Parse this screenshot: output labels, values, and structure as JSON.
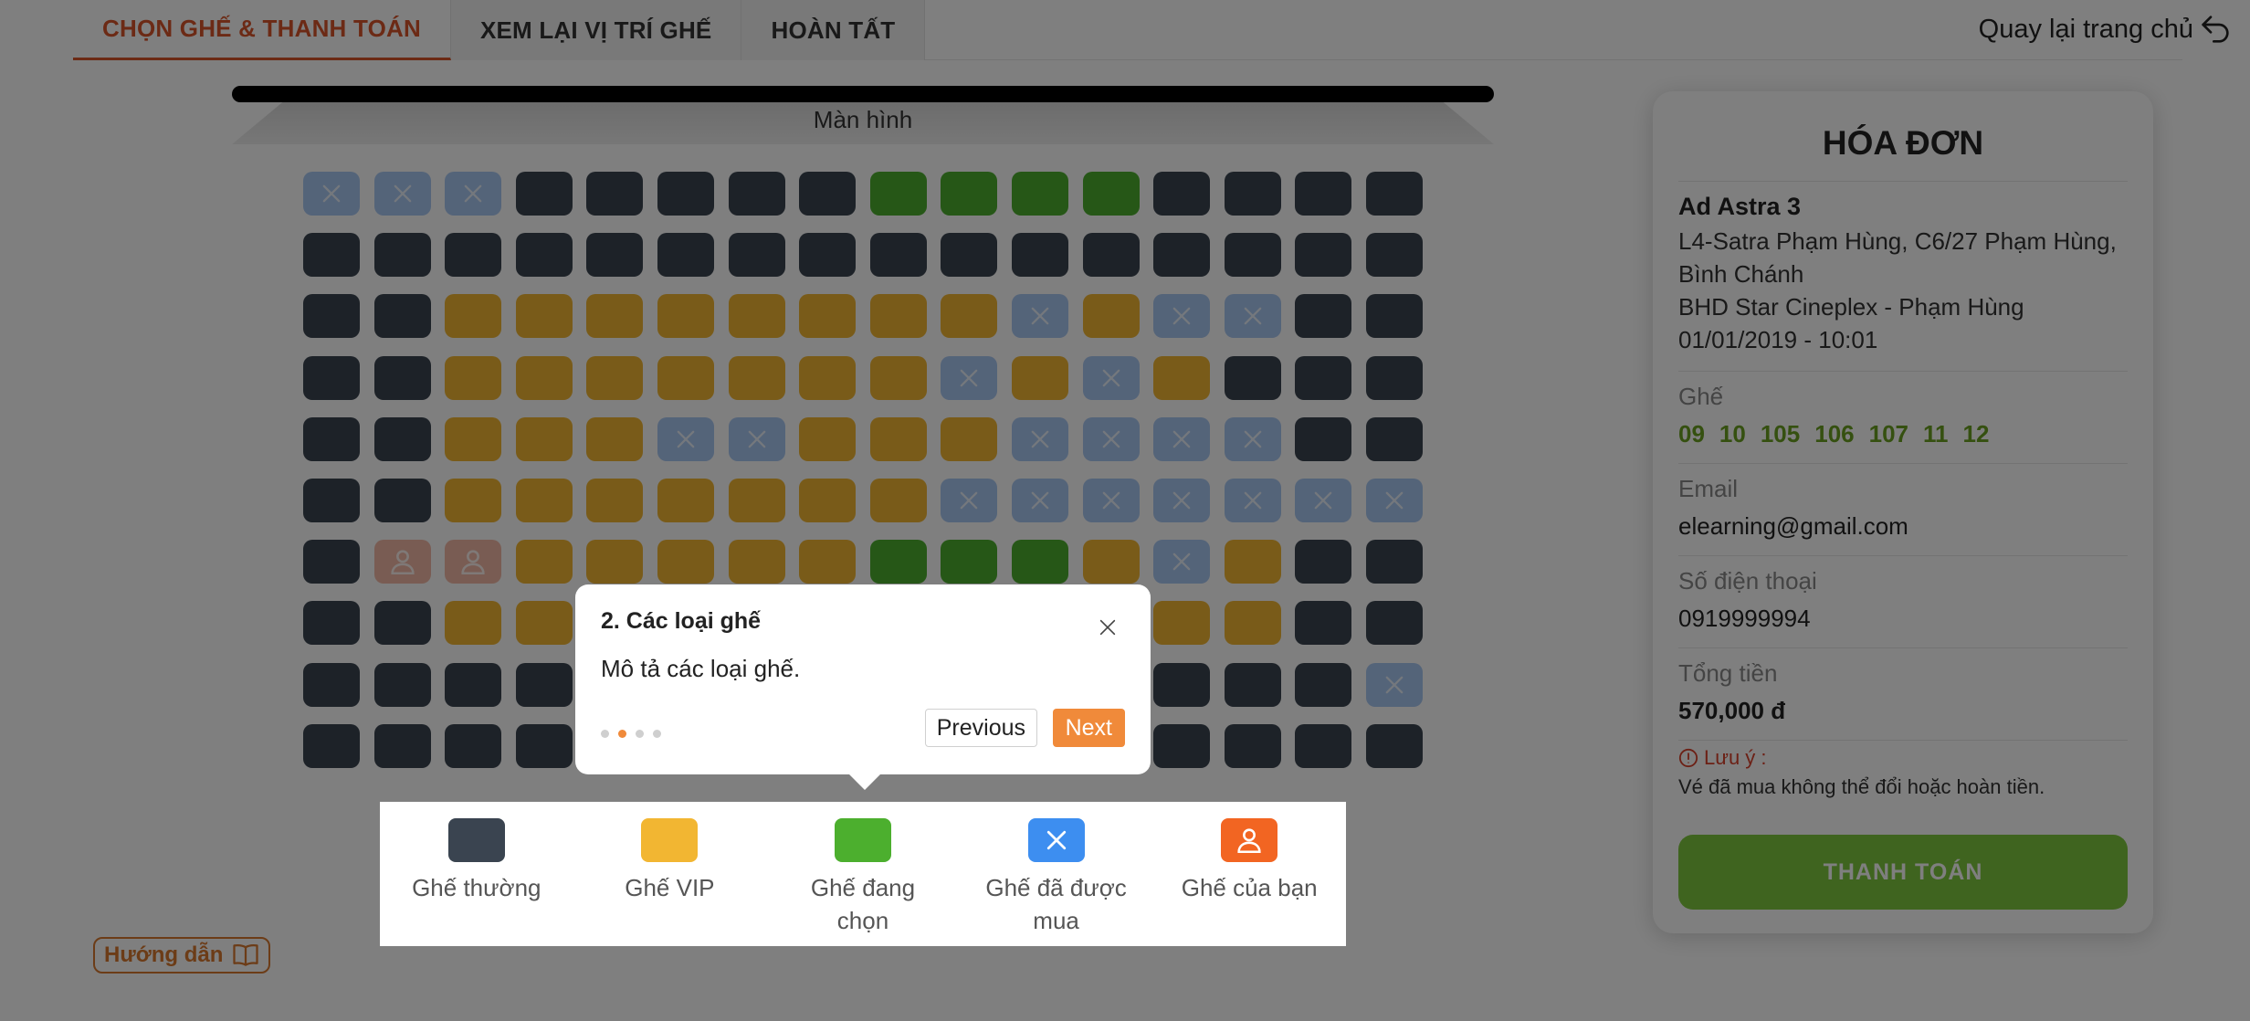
{
  "tabs": [
    {
      "label": "CHỌN GHẾ & THANH TOÁN",
      "active": true
    },
    {
      "label": "XEM LẠI VỊ TRÍ GHẾ",
      "active": false
    },
    {
      "label": "HOÀN TẤT",
      "active": false
    }
  ],
  "header": {
    "back_home": "Quay lại trang chủ",
    "back_icon": "undo-arrow-icon"
  },
  "screen": {
    "label": "Màn hình"
  },
  "seat_map": {
    "legend_codes": {
      "N": "normal",
      "V": "vip",
      "S": "selected",
      "X": "sold",
      "Y": "yours"
    },
    "rows": [
      "XXXNNNNNSSSSNNNN",
      "NNNNNNNNNNNNNNNN",
      "NNVVVVVVVVXVXXNN",
      "NNVVVVVVVXVXVNNN",
      "NNVVVXXVVVXXXXNN",
      "NNVVVVVVVXXXXXXX",
      "NYYVVVVVSSSVXVNN",
      "NNVVVVVVVVVVVVNN",
      "NNNNNNNNNNNNNNNX",
      "NNNNNNNNNNNNNNNN"
    ]
  },
  "legend": [
    {
      "label": "Ghế thường",
      "type": "normal",
      "color": "#3a4450"
    },
    {
      "label": "Ghế VIP",
      "type": "vip",
      "color": "#f2b632"
    },
    {
      "label": "Ghế đang chọn",
      "type": "selected",
      "color": "#4caf2e"
    },
    {
      "label": "Ghế đã được mua",
      "type": "sold",
      "color": "#3d8ef0"
    },
    {
      "label": "Ghế của bạn",
      "type": "yours",
      "color": "#f26522"
    }
  ],
  "guide": {
    "label": "Hướng dẫn",
    "icon": "book-icon"
  },
  "invoice": {
    "title": "HÓA ĐƠN",
    "movie": "Ad Astra 3",
    "address_1": "L4-Satra Phạm Hùng, C6/27 Phạm Hùng,",
    "address_2": "Bình Chánh",
    "cinema": "BHD Star Cineplex - Phạm Hùng",
    "datetime": "01/01/2019 - 10:01",
    "seats_label": "Ghế",
    "seats": [
      "09",
      "10",
      "105",
      "106",
      "107",
      "11",
      "12"
    ],
    "email_label": "Email",
    "email": "elearning@gmail.com",
    "phone_label": "Số điện thoại",
    "phone": "0919999994",
    "total_label": "Tổng tiền",
    "total": "570,000 đ",
    "note_title": "Lưu ý :",
    "note_text": "Vé đã mua không thể đổi hoặc hoàn tiền.",
    "pay_button": "THANH TOÁN"
  },
  "tour": {
    "title": "2. Các loại ghế",
    "description": "Mô tả các loại ghế.",
    "step": 2,
    "total_steps": 4,
    "prev": "Previous",
    "next": "Next"
  }
}
